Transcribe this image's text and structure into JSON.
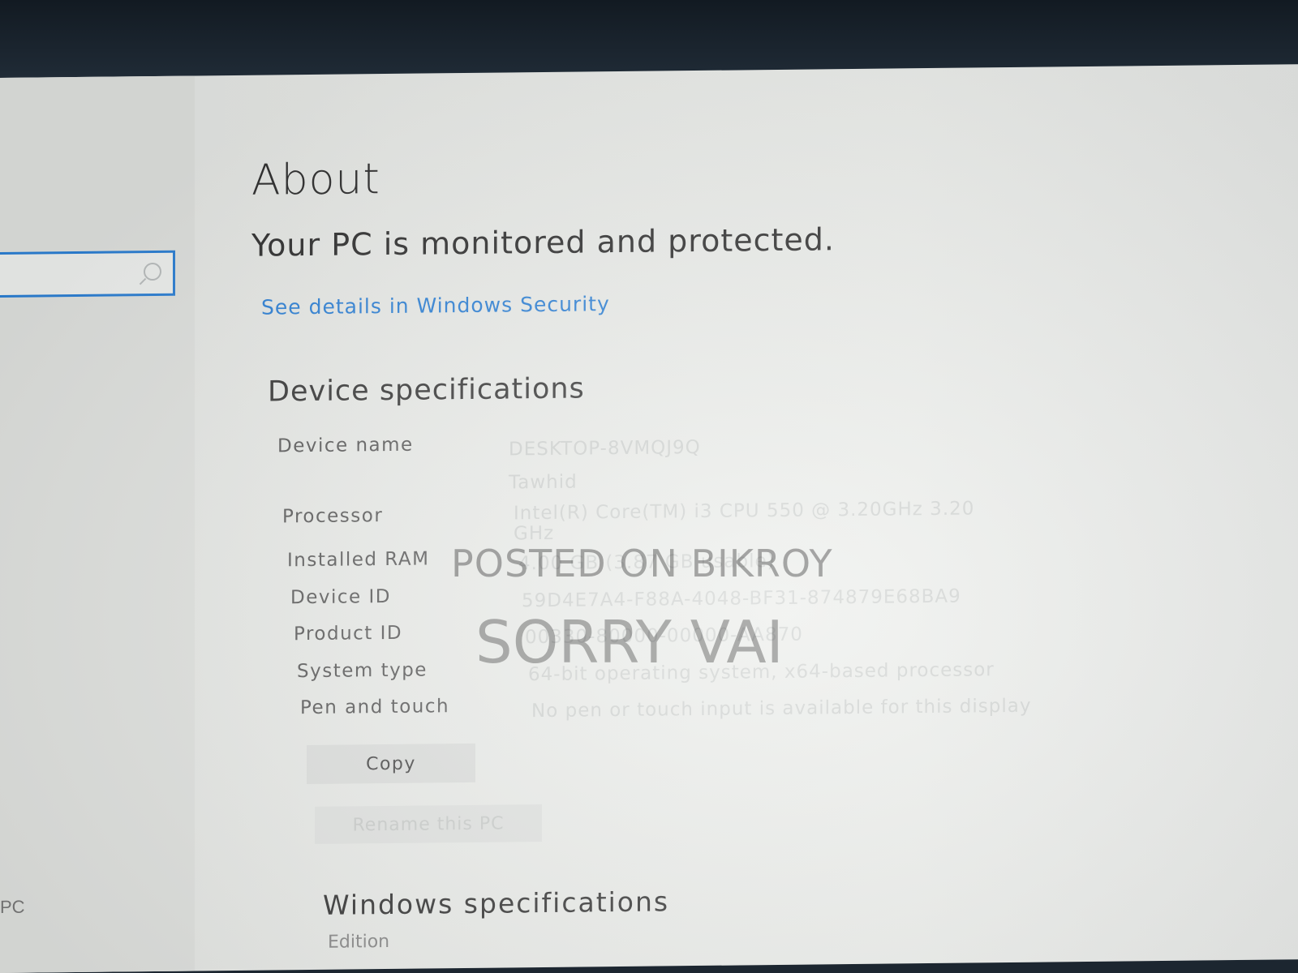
{
  "about": {
    "title": "About",
    "protection_message": "Your PC is monitored and protected.",
    "security_link": "See details in Windows Security"
  },
  "device_specs": {
    "title": "Device specifications",
    "rows": [
      {
        "label": "Device name",
        "value": "DESKTOP-8VMQJ9Q",
        "value2": "Tawhid"
      },
      {
        "label": "Processor",
        "value": "Intel(R) Core(TM) i3 CPU 550 @ 3.20GHz 3.20",
        "value2": "GHz"
      },
      {
        "label": "Installed RAM",
        "value": "4.00 GB (3.87 GB usable)"
      },
      {
        "label": "Device ID",
        "value": "59D4E7A4-F88A-4048-BF31-874879E68BA9"
      },
      {
        "label": "Product ID",
        "value": "00330-80000-00000-AA870"
      },
      {
        "label": "System type",
        "value": "64-bit operating system, x64-based processor"
      },
      {
        "label": "Pen and touch",
        "value": "No pen or touch input is available for this display"
      }
    ],
    "copy_button": "Copy",
    "rename_button": "Rename this PC"
  },
  "windows_specs": {
    "title": "Windows specifications",
    "edition_label": "Edition"
  },
  "sidebar": {
    "bottom_text": "PC"
  },
  "watermarks": {
    "line1": "POSTED ON BIKROY",
    "line2": "SORRY VAI"
  },
  "colors": {
    "accent": "#2a7fd6",
    "search_border": "#2b7fd4"
  }
}
